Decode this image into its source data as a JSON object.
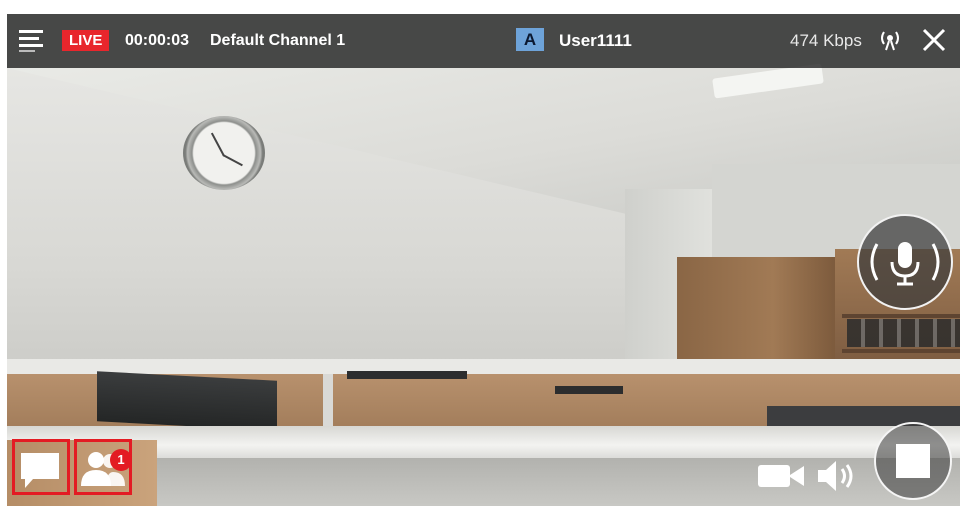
{
  "topbar": {
    "live_label": "LIVE",
    "elapsed_time": "00:00:03",
    "channel_name": "Default Channel 1",
    "user_badge": "A",
    "user_name": "User1111",
    "bitrate": "474 Kbps"
  },
  "controls": {
    "participants_count": "1"
  },
  "colors": {
    "live_red": "#e8262c",
    "badge_blue": "#6ea3d9",
    "highlight_border": "#e31b23"
  },
  "icons": [
    "menu-icon",
    "signal-icon",
    "close-icon",
    "microphone-icon",
    "chat-icon",
    "participants-icon",
    "video-camera-icon",
    "speaker-icon",
    "stop-icon"
  ]
}
